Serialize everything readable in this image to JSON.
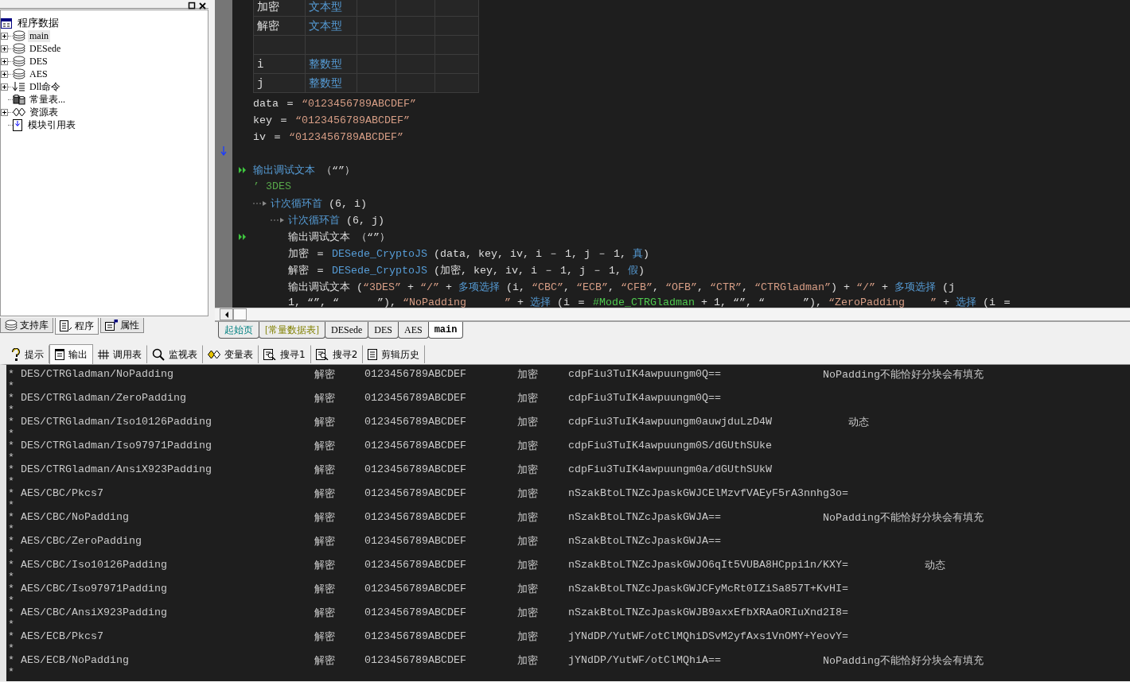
{
  "tree": {
    "label": "程序数据",
    "kind": "root",
    "children": [
      {
        "label": "main",
        "kind": "module",
        "expandable": true,
        "selected": true
      },
      {
        "label": "DESede",
        "kind": "module",
        "expandable": true,
        "selected": false
      },
      {
        "label": "DES",
        "kind": "module",
        "expandable": true,
        "selected": false
      },
      {
        "label": "AES",
        "kind": "module",
        "expandable": true,
        "selected": false
      },
      {
        "label": "Dll命令",
        "kind": "dll",
        "expandable": true,
        "selected": false
      },
      {
        "label": "常量表...",
        "kind": "constant",
        "expandable": false,
        "selected": false
      },
      {
        "label": "资源表",
        "kind": "resource",
        "expandable": true,
        "selected": false
      },
      {
        "label": "模块引用表",
        "kind": "reference",
        "expandable": false,
        "selected": false
      }
    ]
  },
  "left_tabs": [
    {
      "label": "支持库",
      "kind": "library",
      "selected": false
    },
    {
      "label": "程序",
      "kind": "program",
      "selected": true
    },
    {
      "label": "属性",
      "kind": "properties",
      "selected": false
    }
  ],
  "variables": [
    {
      "kind": "variable",
      "name": "加密",
      "type": "文本型"
    },
    {
      "kind": "variable",
      "name": "解密",
      "type": "文本型"
    },
    {
      "kind": "blank"
    },
    {
      "kind": "variable",
      "name": "i",
      "type": "整数型"
    },
    {
      "kind": "variable",
      "name": "j",
      "type": "整数型"
    }
  ],
  "assignments": [
    [
      {
        "kind": "plain",
        "text": "data ＝ "
      },
      {
        "kind": "string",
        "text": "“0123456789ABCDEF”"
      }
    ],
    [
      {
        "kind": "plain",
        "text": "key ＝ "
      },
      {
        "kind": "string",
        "text": "“0123456789ABCDEF”"
      }
    ],
    [
      {
        "kind": "plain",
        "text": "iv ＝ "
      },
      {
        "kind": "string",
        "text": "“0123456789ABCDEF”"
      }
    ]
  ],
  "statements": [
    {
      "kind": "statement",
      "marker": true,
      "tokens": [
        {
          "kind": "keyword",
          "text": "输出调试文本"
        },
        {
          "kind": "plain",
          "text": " （“”）"
        }
      ]
    },
    {
      "kind": "comment",
      "marker": false,
      "tokens": [
        {
          "kind": "comment",
          "text": "’ 3DES"
        }
      ]
    },
    {
      "kind": "loop",
      "marker": false,
      "tokens": [
        {
          "kind": "keyword",
          "text": "计次循环首"
        },
        {
          "kind": "plain",
          "text": " (6, i)"
        }
      ],
      "children": [
        {
          "kind": "loop",
          "marker": false,
          "tokens": [
            {
              "kind": "keyword",
              "text": "计次循环首"
            },
            {
              "kind": "plain",
              "text": " (6, j)"
            }
          ],
          "children": [
            {
              "kind": "statement",
              "marker": true,
              "tokens": [
                {
                  "kind": "plain",
                  "text": "输出调试文本 （“”）"
                }
              ]
            },
            {
              "kind": "statement",
              "marker": false,
              "tokens": [
                {
                  "kind": "plain",
                  "text": "加密 ＝ "
                },
                {
                  "kind": "keyword",
                  "text": "DESede_CryptoJS"
                },
                {
                  "kind": "plain",
                  "text": " (data, key, iv, i － 1, j － 1, "
                },
                {
                  "kind": "keyword",
                  "text": "真"
                },
                {
                  "kind": "plain",
                  "text": ")"
                }
              ]
            },
            {
              "kind": "statement",
              "marker": false,
              "tokens": [
                {
                  "kind": "plain",
                  "text": "解密 ＝ "
                },
                {
                  "kind": "keyword",
                  "text": "DESede_CryptoJS"
                },
                {
                  "kind": "plain",
                  "text": " (加密, key, iv, i － 1, j － 1, "
                },
                {
                  "kind": "keyword",
                  "text": "假"
                },
                {
                  "kind": "plain",
                  "text": ")"
                }
              ]
            },
            {
              "kind": "statement",
              "marker": false,
              "tokens": [
                {
                  "kind": "plain",
                  "text": "输出调试文本 ("
                },
                {
                  "kind": "string",
                  "text": "“3DES”"
                },
                {
                  "kind": "plain",
                  "text": " + "
                },
                {
                  "kind": "string",
                  "text": "“/”"
                },
                {
                  "kind": "plain",
                  "text": " + "
                },
                {
                  "kind": "keyword",
                  "text": "多项选择"
                },
                {
                  "kind": "plain",
                  "text": " (i, "
                },
                {
                  "kind": "string",
                  "text": "“CBC”"
                },
                {
                  "kind": "plain",
                  "text": ", "
                },
                {
                  "kind": "string",
                  "text": "“ECB”"
                },
                {
                  "kind": "plain",
                  "text": ", "
                },
                {
                  "kind": "string",
                  "text": "“CFB”"
                },
                {
                  "kind": "plain",
                  "text": ", "
                },
                {
                  "kind": "string",
                  "text": "“OFB”"
                },
                {
                  "kind": "plain",
                  "text": ", "
                },
                {
                  "kind": "string",
                  "text": "“CTR”"
                },
                {
                  "kind": "plain",
                  "text": ", "
                },
                {
                  "kind": "string",
                  "text": "“CTRGladman”"
                },
                {
                  "kind": "plain",
                  "text": ") + "
                },
                {
                  "kind": "string",
                  "text": "“/”"
                },
                {
                  "kind": "plain",
                  "text": " + "
                },
                {
                  "kind": "keyword",
                  "text": "多项选择"
                },
                {
                  "kind": "plain",
                  "text": " (j"
                }
              ]
            },
            {
              "kind": "continuation",
              "marker": false,
              "tokens": [
                {
                  "kind": "plain",
                  "text": "1, “”, “      ”), "
                },
                {
                  "kind": "string",
                  "text": "“NoPadding      ”"
                },
                {
                  "kind": "plain",
                  "text": " + "
                },
                {
                  "kind": "keyword",
                  "text": "选择"
                },
                {
                  "kind": "plain",
                  "text": " (i ＝ "
                },
                {
                  "kind": "constant",
                  "text": "#Mode_CTRGladman"
                },
                {
                  "kind": "plain",
                  "text": " + 1, “”, “      ”), "
                },
                {
                  "kind": "string",
                  "text": "“ZeroPadding    ”"
                },
                {
                  "kind": "plain",
                  "text": " + "
                },
                {
                  "kind": "keyword",
                  "text": "选择"
                },
                {
                  "kind": "plain",
                  "text": " (i ＝"
                }
              ]
            }
          ]
        }
      ]
    }
  ],
  "editor_tabs": [
    {
      "label": "起始页",
      "kind": "start",
      "selected": false
    },
    {
      "label": "[常量数据表]",
      "kind": "constants",
      "selected": false
    },
    {
      "label": "DESede",
      "kind": "module",
      "selected": false
    },
    {
      "label": "DES",
      "kind": "module",
      "selected": false
    },
    {
      "label": "AES",
      "kind": "module",
      "selected": false
    },
    {
      "label": "main",
      "kind": "module",
      "selected": true
    }
  ],
  "bottom_tabs": [
    {
      "label": "提示",
      "kind": "hint",
      "selected": false
    },
    {
      "label": "输出",
      "kind": "output",
      "selected": true
    },
    {
      "label": "调用表",
      "kind": "calls",
      "selected": false
    },
    {
      "label": "监视表",
      "kind": "watch",
      "selected": false
    },
    {
      "label": "变量表",
      "kind": "variables",
      "selected": false
    },
    {
      "label": "搜寻1",
      "kind": "search",
      "selected": false
    },
    {
      "label": "搜寻2",
      "kind": "search",
      "selected": false
    },
    {
      "label": "剪辑历史",
      "kind": "history",
      "selected": false
    }
  ],
  "output": [
    {
      "cells": [
        "* DES/CTRGladman/NoPadding",
        "解密",
        "0123456789ABCDEF",
        "加密",
        "cdpFiu3TuIK4awpuungm0Q=="
      ],
      "note": "NoPadding不能恰好分块会有填充",
      "tail": "*"
    },
    {
      "cells": [
        "* DES/CTRGladman/ZeroPadding",
        "解密",
        "0123456789ABCDEF",
        "加密",
        "cdpFiu3TuIK4awpuungm0Q=="
      ],
      "tail": "*"
    },
    {
      "cells": [
        "* DES/CTRGladman/Iso10126Padding",
        "解密",
        "0123456789ABCDEF",
        "加密",
        "cdpFiu3TuIK4awpuungm0auwjduLzD4W"
      ],
      "note": "动态",
      "tail": "*"
    },
    {
      "cells": [
        "* DES/CTRGladman/Iso97971Padding",
        "解密",
        "0123456789ABCDEF",
        "加密",
        "cdpFiu3TuIK4awpuungm0S/dGUthSUke"
      ],
      "tail": "*"
    },
    {
      "cells": [
        "* DES/CTRGladman/AnsiX923Padding",
        "解密",
        "0123456789ABCDEF",
        "加密",
        "cdpFiu3TuIK4awpuungm0a/dGUthSUkW"
      ],
      "tail": "*"
    },
    {
      "cells": [
        "* AES/CBC/Pkcs7",
        "解密",
        "0123456789ABCDEF",
        "加密",
        "nSzakBtoLTNZcJpaskGWJCElMzvfVAEyF5rA3nnhg3o="
      ],
      "tail": "*"
    },
    {
      "cells": [
        "* AES/CBC/NoPadding",
        "解密",
        "0123456789ABCDEF",
        "加密",
        "nSzakBtoLTNZcJpaskGWJA=="
      ],
      "note": "NoPadding不能恰好分块会有填充",
      "tail": "*"
    },
    {
      "cells": [
        "* AES/CBC/ZeroPadding",
        "解密",
        "0123456789ABCDEF",
        "加密",
        "nSzakBtoLTNZcJpaskGWJA=="
      ],
      "tail": "*"
    },
    {
      "cells": [
        "* AES/CBC/Iso10126Padding",
        "解密",
        "0123456789ABCDEF",
        "加密",
        "nSzakBtoLTNZcJpaskGWJO6qIt5VUBA8HCppi1n/KXY="
      ],
      "note": "动态",
      "tail": "*"
    },
    {
      "cells": [
        "* AES/CBC/Iso97971Padding",
        "解密",
        "0123456789ABCDEF",
        "加密",
        "nSzakBtoLTNZcJpaskGWJCFyMcRt0IZiSa857T+KvHI="
      ],
      "tail": "*"
    },
    {
      "cells": [
        "* AES/CBC/AnsiX923Padding",
        "解密",
        "0123456789ABCDEF",
        "加密",
        "nSzakBtoLTNZcJpaskGWJB9axxEfbXRAaORIuXnd2I8="
      ],
      "tail": "*"
    },
    {
      "cells": [
        "* AES/ECB/Pkcs7",
        "解密",
        "0123456789ABCDEF",
        "加密",
        "jYNdDP/YutWF/otClMQhiDSvM2yfAxs1VnOMY+YeovY="
      ],
      "tail": "*"
    },
    {
      "cells": [
        "* AES/ECB/NoPadding",
        "解密",
        "0123456789ABCDEF",
        "加密",
        "jYNdDP/YutWF/otClMQhiA=="
      ],
      "note": "NoPadding不能恰好分块会有填充",
      "tail": "*"
    }
  ]
}
